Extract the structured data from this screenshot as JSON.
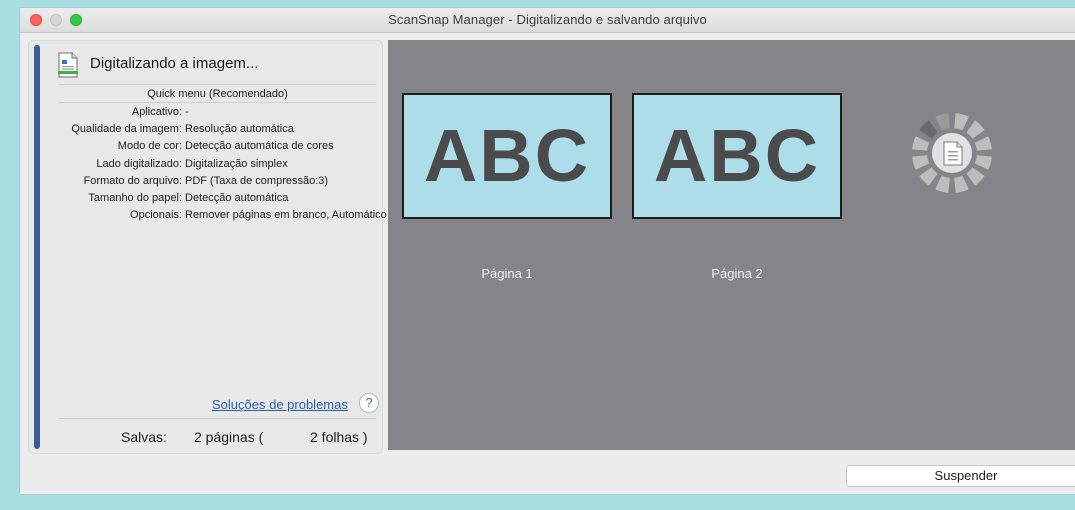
{
  "window": {
    "title": "ScanSnap Manager - Digitalizando e salvando arquivo"
  },
  "status": {
    "text": "Digitalizando a imagem...",
    "icon": "document-scan-icon"
  },
  "profile": {
    "name": "Quick menu (Recomendado)"
  },
  "settings": [
    {
      "key": "Aplicativo:",
      "value": "-"
    },
    {
      "key": "Qualidade da imagem:",
      "value": "Resolução automática"
    },
    {
      "key": "Modo de cor:",
      "value": "Detecção automática de cores"
    },
    {
      "key": "Lado digitalizado:",
      "value": "Digitalização simplex"
    },
    {
      "key": "Formato do arquivo:",
      "value": "PDF (Taxa de compressão:3)"
    },
    {
      "key": "Tamanho do papel:",
      "value": "Detecção automática"
    },
    {
      "key": "Opcionais:",
      "value": "Remover páginas em branco, Automático"
    }
  ],
  "help": {
    "link_text": "Soluções de problemas",
    "button": "?"
  },
  "saved": {
    "label": "Salvas:",
    "pages": "2 páginas (",
    "sheets": "2 folhas )"
  },
  "pages": [
    {
      "thumb_text": "ABC",
      "label": "Página 1"
    },
    {
      "thumb_text": "ABC",
      "label": "Página 2"
    }
  ],
  "spinner_icon": "loading-spinner-icon",
  "actions": {
    "suspend": "Suspender"
  },
  "colors": {
    "background": "#a9dfe2",
    "preview_area": "#858488",
    "thumbnail": "#addde9",
    "side_bar": "#3b5d91",
    "link": "#2a5db0"
  }
}
